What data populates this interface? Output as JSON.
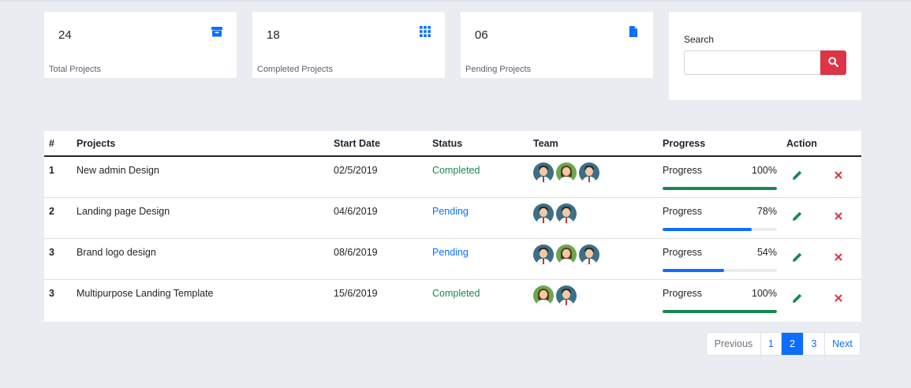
{
  "stats": [
    {
      "count": "24",
      "label": "Total Projects",
      "icon": "archive-icon"
    },
    {
      "count": "18",
      "label": "Completed Projects",
      "icon": "grid-icon"
    },
    {
      "count": "06",
      "label": "Pending Projects",
      "icon": "file-icon"
    }
  ],
  "search": {
    "label": "Search",
    "placeholder": "",
    "value": "",
    "button_icon": "search-icon"
  },
  "table": {
    "headers": {
      "num": "#",
      "projects": "Projects",
      "start_date": "Start Date",
      "status": "Status",
      "team": "Team",
      "progress": "Progress",
      "action": "Action"
    },
    "rows": [
      {
        "num": "1",
        "project": "New admin Design",
        "start_date": "02/5/2019",
        "status": "Completed",
        "team": [
          "male",
          "female",
          "male"
        ],
        "progress_label": "Progress",
        "progress_value": "100%",
        "progress": 100
      },
      {
        "num": "2",
        "project": "Landing page Design",
        "start_date": "04/6/2019",
        "status": "Pending",
        "team": [
          "male",
          "male"
        ],
        "progress_label": "Progress",
        "progress_value": "78%",
        "progress": 78
      },
      {
        "num": "3",
        "project": "Brand logo design",
        "start_date": "08/6/2019",
        "status": "Pending",
        "team": [
          "male",
          "female",
          "male"
        ],
        "progress_label": "Progress",
        "progress_value": "54%",
        "progress": 54
      },
      {
        "num": "3",
        "project": "Multipurpose Landing Template",
        "start_date": "15/6/2019",
        "status": "Completed",
        "team": [
          "female",
          "male"
        ],
        "progress_label": "Progress",
        "progress_value": "100%",
        "progress": 100
      }
    ]
  },
  "pagination": {
    "previous": "Previous",
    "pages": [
      "1",
      "2",
      "3"
    ],
    "active_page": "2",
    "next": "Next"
  },
  "colors": {
    "accent": "#0d6efd",
    "completed": "#198754",
    "pending": "#0d6efd",
    "danger": "#dc3545",
    "edit": "#198754"
  }
}
